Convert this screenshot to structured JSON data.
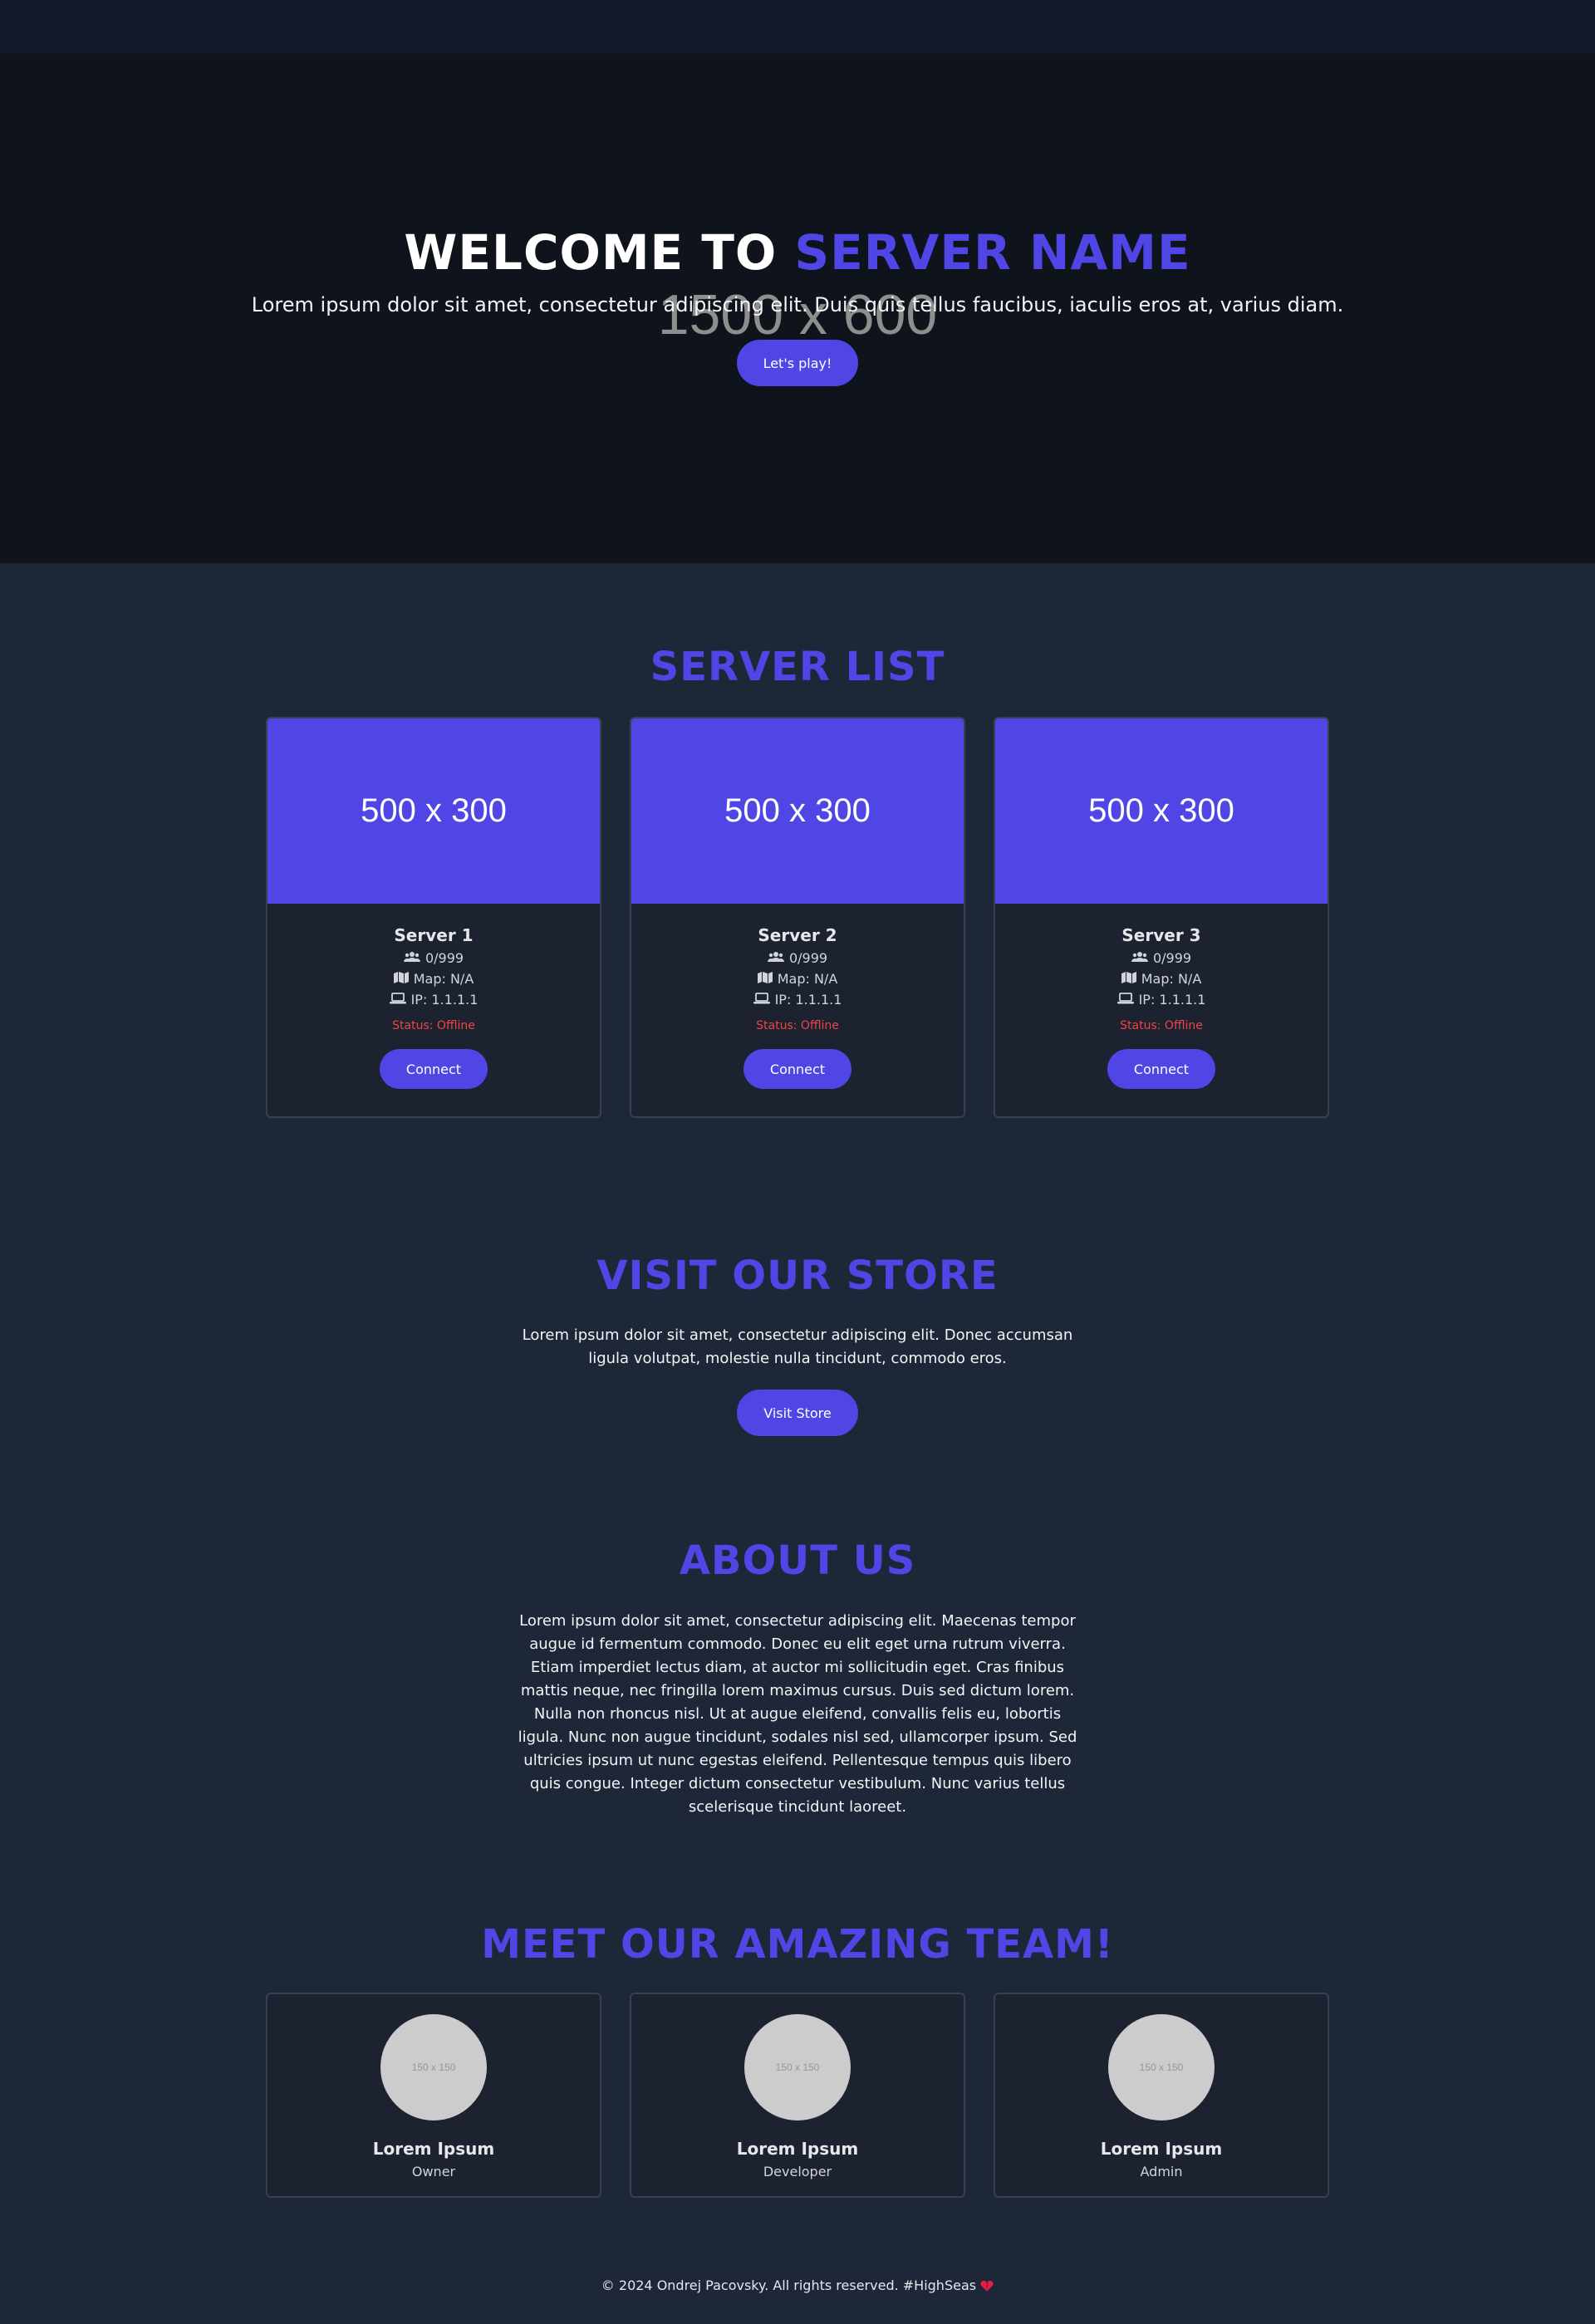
{
  "hero": {
    "placeholder": "1500 x 600",
    "title_prefix": "WELCOME TO ",
    "title_accent": "SERVER NAME",
    "subtitle": "Lorem ipsum dolor sit amet, consectetur adipiscing elit. Duis quis tellus faucibus, iaculis eros at, varius diam.",
    "button": "Let's play!"
  },
  "server_list": {
    "title": "SERVER LIST",
    "servers": [
      {
        "image": "500 x 300",
        "name": "Server 1",
        "players": "0/999",
        "map": "Map: N/A",
        "ip": "IP: 1.1.1.1",
        "status": "Status: Offline",
        "button": "Connect"
      },
      {
        "image": "500 x 300",
        "name": "Server 2",
        "players": "0/999",
        "map": "Map: N/A",
        "ip": "IP: 1.1.1.1",
        "status": "Status: Offline",
        "button": "Connect"
      },
      {
        "image": "500 x 300",
        "name": "Server 3",
        "players": "0/999",
        "map": "Map: N/A",
        "ip": "IP: 1.1.1.1",
        "status": "Status: Offline",
        "button": "Connect"
      }
    ]
  },
  "store": {
    "title": "VISIT OUR STORE",
    "text": "Lorem ipsum dolor sit amet, consectetur adipiscing elit. Donec accumsan ligula volutpat, molestie nulla tincidunt, commodo eros.",
    "button": "Visit Store"
  },
  "about": {
    "title": "ABOUT US",
    "text": "Lorem ipsum dolor sit amet, consectetur adipiscing elit. Maecenas tempor augue id fermentum commodo. Donec eu elit eget urna rutrum viverra. Etiam imperdiet lectus diam, at auctor mi sollicitudin eget. Cras finibus mattis neque, nec fringilla lorem maximus cursus. Duis sed dictum lorem. Nulla non rhoncus nisl. Ut at augue eleifend, convallis felis eu, lobortis ligula. Nunc non augue tincidunt, sodales nisl sed, ullamcorper ipsum. Sed ultricies ipsum ut nunc egestas eleifend. Pellentesque tempus quis libero quis congue. Integer dictum consectetur vestibulum. Nunc varius tellus scelerisque tincidunt laoreet."
  },
  "team": {
    "title": "MEET OUR AMAZING TEAM!",
    "members": [
      {
        "avatar": "150 x 150",
        "name": "Lorem Ipsum",
        "role": "Owner"
      },
      {
        "avatar": "150 x 150",
        "name": "Lorem Ipsum",
        "role": "Developer"
      },
      {
        "avatar": "150 x 150",
        "name": "Lorem Ipsum",
        "role": "Admin"
      }
    ]
  },
  "footer": {
    "text": "© 2024 Ondrej Pacovsky. All rights reserved. #HighSeas",
    "icon": "heart-icon"
  },
  "colors": {
    "accent": "#4f46e5",
    "status_offline": "#ef4444",
    "page_bg": "#1e2738",
    "hero_bg": "#0f131b"
  }
}
